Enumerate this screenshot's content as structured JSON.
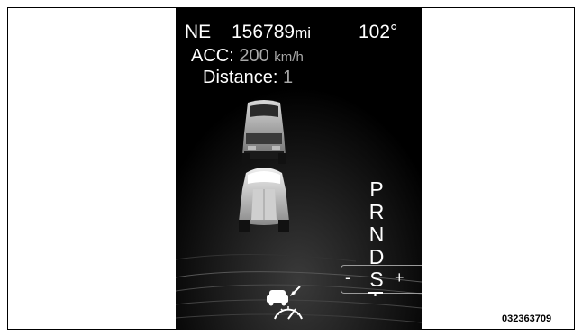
{
  "status": {
    "compass_heading": "NE",
    "odometer_value": "156789",
    "odometer_unit": "mi",
    "outside_temp": "102°"
  },
  "acc": {
    "label": "ACC:",
    "set_speed": "200",
    "speed_unit": "km/h"
  },
  "distance": {
    "label": "Distance:",
    "value": "1"
  },
  "gear_selector": {
    "gears": [
      "P",
      "R",
      "N",
      "D",
      "S"
    ],
    "selected": "D",
    "shift_minus": "-",
    "shift_plus": "+"
  },
  "icons": {
    "acc_indicator": "acc-vehicle-speedometer-icon",
    "lead_vehicle": "lead-vehicle-icon",
    "own_vehicle": "own-vehicle-icon"
  },
  "figure_code": "032363709",
  "colors": {
    "display_bg": "#000000",
    "primary_text": "#ffffff",
    "secondary_text": "#a8a8a8"
  }
}
